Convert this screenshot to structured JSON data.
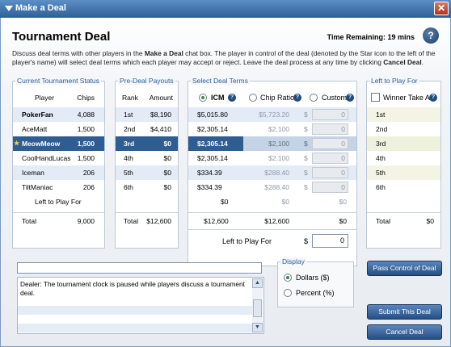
{
  "window": {
    "title": "Make a Deal",
    "close_glyph": "✕"
  },
  "heading": "Tournament Deal",
  "timer": "Time Remaining: 19 mins",
  "help_glyph": "?",
  "description": {
    "p1": "Discuss deal terms with other players in the ",
    "b1": "Make a Deal",
    "p2": " chat box. The player in control of the deal (denoted by the Star icon to the left of the player's name) will select deal terms which each player may accept or reject. Leave the deal process at any time by clicking ",
    "b2": "Cancel Deal",
    "p3": "."
  },
  "status": {
    "title": "Current Tournament Status",
    "col_player": "Player",
    "col_chips": "Chips",
    "rows": [
      {
        "player": "PokerFan",
        "chips": "4,088"
      },
      {
        "player": "AceMatt",
        "chips": "1,500"
      },
      {
        "player": "MeowMeow",
        "chips": "1,500"
      },
      {
        "player": "CoolHandLucas",
        "chips": "1,500"
      },
      {
        "player": "Iceman",
        "chips": "206"
      },
      {
        "player": "TiltManiac",
        "chips": "206"
      }
    ],
    "left_to_play": "Left to Play For",
    "total_label": "Total",
    "total_chips": "9,000",
    "star_glyph": "★"
  },
  "payouts": {
    "title": "Pre-Deal Payouts",
    "col_rank": "Rank",
    "col_amount": "Amount",
    "rows": [
      {
        "rank": "1st",
        "amount": "$8,190"
      },
      {
        "rank": "2nd",
        "amount": "$4,410"
      },
      {
        "rank": "3rd",
        "amount": "$0"
      },
      {
        "rank": "4th",
        "amount": "$0"
      },
      {
        "rank": "5th",
        "amount": "$0"
      },
      {
        "rank": "6th",
        "amount": "$0"
      }
    ],
    "total_label": "Total",
    "total_amount": "$12,600"
  },
  "terms": {
    "title": "Select Deal Terms",
    "opt_icm": "ICM",
    "opt_chip": "Chip Ratio",
    "opt_custom": "Custom",
    "rows": [
      {
        "icm": "$5,015.80",
        "chip": "$5,723.20",
        "cur": "$",
        "custom": "0"
      },
      {
        "icm": "$2,305.14",
        "chip": "$2,100",
        "cur": "$",
        "custom": "0"
      },
      {
        "icm": "$2,305.14",
        "chip": "$2,100",
        "cur": "$",
        "custom": "0"
      },
      {
        "icm": "$2,305.14",
        "chip": "$2,100",
        "cur": "$",
        "custom": "0"
      },
      {
        "icm": "$334.39",
        "chip": "$288.40",
        "cur": "$",
        "custom": "0"
      },
      {
        "icm": "$334.39",
        "chip": "$288.40",
        "cur": "$",
        "custom": "0"
      }
    ],
    "ltp_icm": "$0",
    "ltp_chip": "$0",
    "ltp_custom": "$0",
    "total_icm": "$12,600",
    "total_chip": "$12,600",
    "total_custom": "$0",
    "left_to_play_label": "Left to Play For",
    "left_to_play_cur": "$",
    "left_to_play_value": "0"
  },
  "left_panel": {
    "title": "Left to Play For",
    "winner_take_all": "Winner Take All",
    "rows": [
      "1st",
      "2nd",
      "3rd",
      "4th",
      "5th",
      "6th"
    ],
    "total_label": "Total",
    "total_value": "$0"
  },
  "chat": {
    "input_value": "",
    "message": "Dealer: The tournament clock is paused while players discuss a tournament deal.",
    "up_glyph": "▲",
    "down_glyph": "▼"
  },
  "display": {
    "title": "Display",
    "dollars": "Dollars ($)",
    "percent": "Percent (%)"
  },
  "buttons": {
    "pass_control": "Pass Control of Deal",
    "submit": "Submit This Deal",
    "cancel": "Cancel Deal"
  },
  "colors": {
    "title_bar": "#2e5f97",
    "selected_row": "#2f5c91",
    "accent": "#2c5e99"
  }
}
